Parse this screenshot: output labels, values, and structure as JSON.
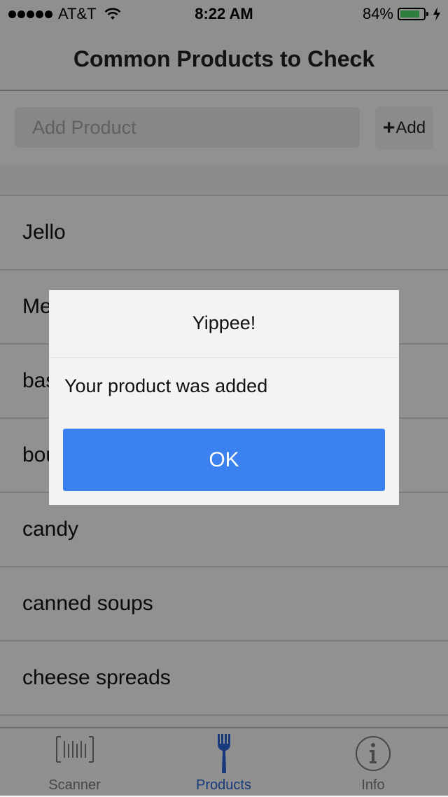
{
  "status_bar": {
    "carrier": "AT&T",
    "time": "8:22 AM",
    "battery_percent": "84%",
    "battery_level": 0.84,
    "battery_color": "#4cd964"
  },
  "nav": {
    "title": "Common Products to Check"
  },
  "add_product": {
    "placeholder": "Add Product",
    "value": "",
    "button_plus": "+",
    "button_label": "Add"
  },
  "list": {
    "items": [
      {
        "label": "Jello"
      },
      {
        "label": "Meat"
      },
      {
        "label": "basted meats"
      },
      {
        "label": "bouillon"
      },
      {
        "label": "candy"
      },
      {
        "label": "canned soups"
      },
      {
        "label": "cheese spreads"
      }
    ]
  },
  "tabs": [
    {
      "label": "Scanner",
      "icon": "barcode-icon",
      "active": false
    },
    {
      "label": "Products",
      "icon": "fork-icon",
      "active": true
    },
    {
      "label": "Info",
      "icon": "info-icon",
      "active": false
    }
  ],
  "dialog": {
    "title": "Yippee!",
    "message": "Your product was added",
    "ok_label": "OK",
    "ok_color": "#3b82f0"
  },
  "colors": {
    "active_tab": "#2a64d6",
    "overlay": "rgba(0,0,0,0.42)"
  }
}
